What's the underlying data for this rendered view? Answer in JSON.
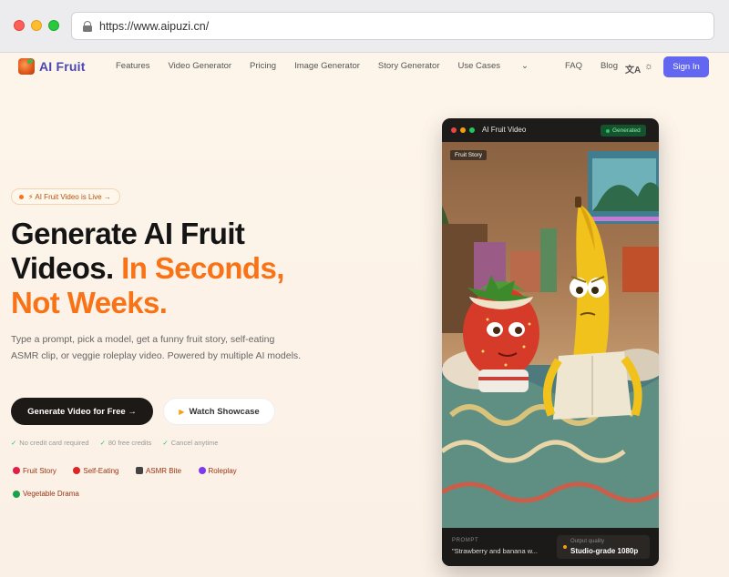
{
  "browser": {
    "url": "https://www.aipuzi.cn/"
  },
  "nav": {
    "logo_text": "AI Fruit",
    "links": [
      "Features",
      "Video Generator",
      "Pricing",
      "Image Generator",
      "Story Generator",
      "Use Cases",
      "FAQ",
      "Blog"
    ],
    "signin_label": "Sign In"
  },
  "hero": {
    "badge": "⚡ AI Fruit Video is Live →",
    "headline_line1": "Generate AI Fruit",
    "headline_line2a": "Videos.",
    "headline_line2b": "In Seconds,",
    "headline_line3": "Not Weeks.",
    "subtitle": "Type a prompt, pick a model, get a funny fruit story, self-eating ASMR clip, or veggie roleplay video. Powered by multiple AI models.",
    "cta_primary": "Generate Video for Free →",
    "cta_secondary": "Watch Showcase",
    "perks": [
      "No credit card required",
      "80 free credits",
      "Cancel anytime"
    ],
    "tags": [
      "Fruit Story",
      "Self-Eating",
      "ASMR Bite",
      "Roleplay",
      "Vegetable Drama"
    ]
  },
  "video_card": {
    "title": "AI Fruit Video",
    "status": "Generated",
    "scene_tag": "Fruit Story",
    "prompt_label": "PROMPT",
    "prompt_text": "\"Strawberry and banana w...",
    "quality_label": "Output quality",
    "quality_value": "Studio-grade 1080p"
  },
  "colors": {
    "accent_orange": "#f97316",
    "brand_indigo": "#6366f1",
    "logo_text": "#4a47b5",
    "background": "#fdf4ea"
  },
  "icons": [
    "lock-icon",
    "translate-icon",
    "sun-icon",
    "play-icon",
    "check-icon"
  ]
}
